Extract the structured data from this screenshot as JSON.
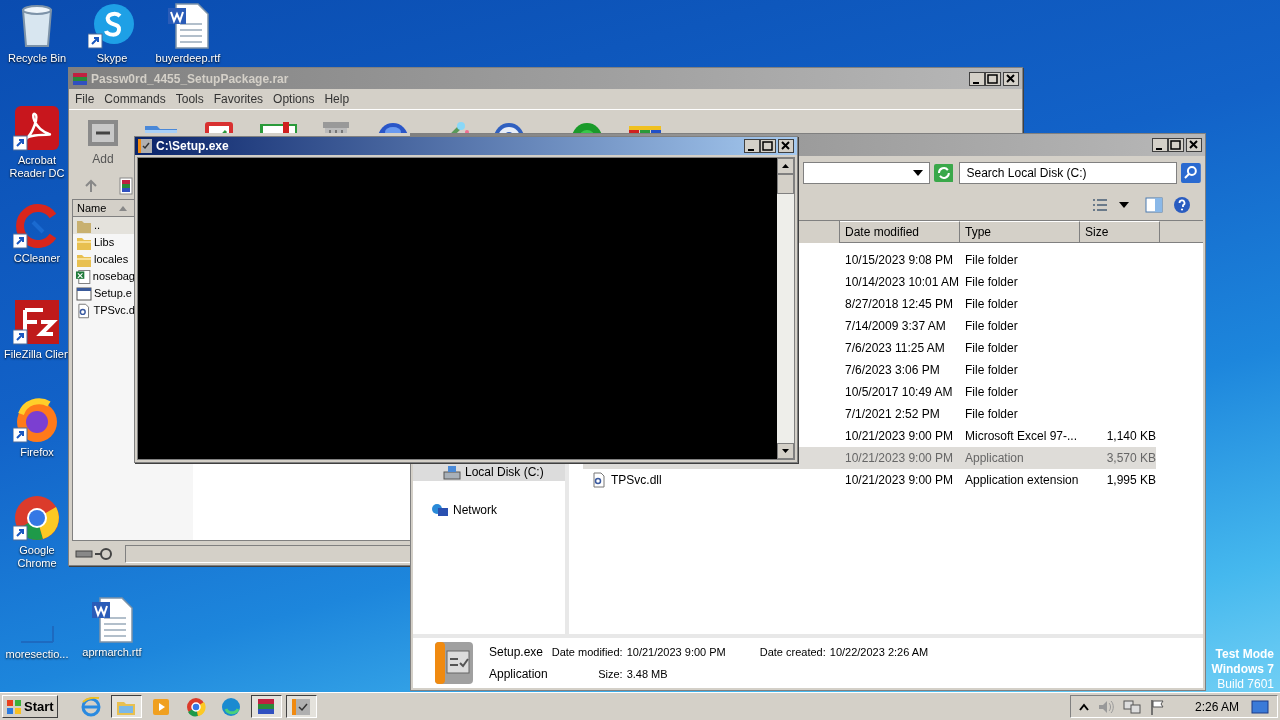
{
  "desktop_icons": [
    {
      "label": "Recycle Bin",
      "kind": "recycle"
    },
    {
      "label": "Skype",
      "kind": "skype"
    },
    {
      "label": "buyerdeep.rtf",
      "kind": "word"
    },
    {
      "label": "Acrobat Reader DC",
      "kind": "acrobat"
    },
    {
      "label": "CCleaner",
      "kind": "ccleaner"
    },
    {
      "label": "FileZilla Clien",
      "kind": "filezilla"
    },
    {
      "label": "Firefox",
      "kind": "firefox"
    },
    {
      "label": "Google Chrome",
      "kind": "chrome"
    },
    {
      "label": "moresectio...",
      "kind": "blank"
    },
    {
      "label": "aprmarch.rtf",
      "kind": "word"
    }
  ],
  "winrar": {
    "title": "Passw0rd_4455_SetupPackage.rar",
    "menu": [
      "File",
      "Commands",
      "Tools",
      "Favorites",
      "Options",
      "Help"
    ],
    "add_label": "Add",
    "list_header": "Name",
    "rows": [
      {
        "name": "..",
        "kind": "up",
        "selected": true
      },
      {
        "name": "Libs",
        "kind": "folder",
        "selected": false
      },
      {
        "name": "locales",
        "kind": "folder",
        "selected": false
      },
      {
        "name": "nosebag",
        "kind": "excel",
        "selected": false
      },
      {
        "name": "Setup.e",
        "kind": "exe",
        "selected": false
      },
      {
        "name": "TPSvc.d",
        "kind": "dll",
        "selected": false
      }
    ]
  },
  "explorer": {
    "search": {
      "placeholder": "Search Local Disk (C:)"
    },
    "columns": [
      "Date modified",
      "Type",
      "Size"
    ],
    "rows": [
      {
        "date": "10/15/2023 9:08 PM",
        "type": "File folder",
        "selected": false
      },
      {
        "date": "10/14/2023 10:01 AM",
        "type": "File folder",
        "selected": false
      },
      {
        "date": "8/27/2018 12:45 PM",
        "type": "File folder",
        "selected": false
      },
      {
        "date": "7/14/2009 3:37 AM",
        "type": "File folder",
        "selected": false
      },
      {
        "date": "7/6/2023 11:25 AM",
        "type": "File folder",
        "selected": false
      },
      {
        "date": "7/6/2023 3:06 PM",
        "type": "File folder",
        "selected": false
      },
      {
        "date": "10/5/2017 10:49 AM",
        "type": "File folder",
        "selected": false
      },
      {
        "date": "7/1/2021 2:52 PM",
        "type": "File folder",
        "selected": false
      },
      {
        "date": "10/21/2023 9:00 PM",
        "type": "Microsoft Excel 97-...",
        "size": "1,140 KB",
        "selected": false
      },
      {
        "date": "10/21/2023 9:00 PM",
        "type": "Application",
        "size": "3,570 KB",
        "selected": true
      },
      {
        "name": "TPSvc.dll",
        "kind": "dll",
        "date": "10/21/2023 9:00 PM",
        "type": "Application extension",
        "size": "1,995 KB",
        "selected": false
      }
    ],
    "nav": [
      {
        "label": "Local Disk (C:)",
        "kind": "drive",
        "selected": true
      },
      {
        "label": "Network",
        "kind": "network",
        "selected": false
      }
    ],
    "details": {
      "name": "Setup.exe",
      "type": "Application",
      "modified_label": "Date modified:",
      "modified": "10/21/2023 9:00 PM",
      "created_label": "Date created:",
      "created": "10/22/2023 2:26 AM",
      "size_label": "Size:",
      "size": "3.48 MB"
    }
  },
  "console": {
    "title": "C:\\Setup.exe"
  },
  "taskbar": {
    "start": "Start",
    "apps": [
      {
        "kind": "ie",
        "pressed": false
      },
      {
        "kind": "folder",
        "pressed": true
      },
      {
        "kind": "media",
        "pressed": false
      },
      {
        "kind": "chrome",
        "pressed": false
      },
      {
        "kind": "edge",
        "pressed": false
      },
      {
        "kind": "winrar",
        "pressed": true
      },
      {
        "kind": "setup",
        "pressed": true
      }
    ],
    "clock": "2:26 AM"
  },
  "test_mode_notice": [
    "Test Mode",
    "Windows 7",
    "Build 7601"
  ]
}
